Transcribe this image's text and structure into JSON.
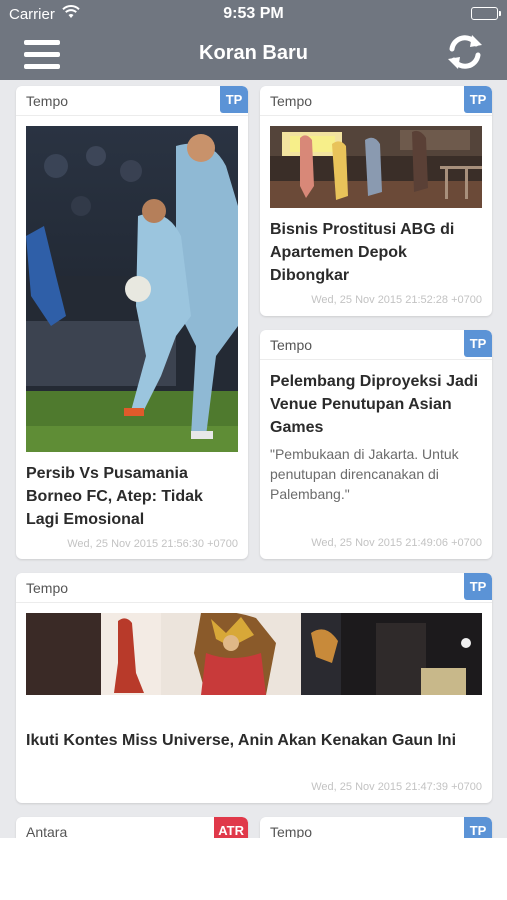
{
  "status_bar": {
    "carrier": "Carrier",
    "time": "9:53 PM"
  },
  "nav": {
    "title": "Koran Baru",
    "menu_icon": "hamburger-icon",
    "refresh_icon": "refresh-icon"
  },
  "colors": {
    "nav_bg": "#707680",
    "feed_bg": "#e8e9ec",
    "badge_tp": "#5b93d6",
    "badge_atr": "#e0394a"
  },
  "articles": [
    {
      "source": "Tempo",
      "badge": "TP",
      "headline": "Persib Vs Pusamania Borneo FC, Atep: Tidak Lagi Emosional",
      "excerpt": "",
      "time": "Wed, 25 Nov 2015 21:56:30 +0700"
    },
    {
      "source": "Tempo",
      "badge": "TP",
      "headline": "Bisnis Prostitusi ABG di Apartemen Depok Dibongkar",
      "excerpt": "",
      "time": "Wed, 25 Nov 2015 21:52:28 +0700"
    },
    {
      "source": "Tempo",
      "badge": "TP",
      "headline": "Pelembang Diproyeksi Jadi Venue Penutupan Asian Games",
      "excerpt": "\"Pembukaan di Jakarta. Untuk penutupan direncanakan di Palembang.\"",
      "time": "Wed, 25 Nov 2015 21:49:06 +0700"
    },
    {
      "source": "Tempo",
      "badge": "TP",
      "headline": "Ikuti Kontes Miss Universe, Anin Akan Kenakan Gaun Ini",
      "excerpt": "",
      "time": "Wed, 25 Nov 2015 21:47:39 +0700"
    },
    {
      "source": "Antara",
      "badge": "ATR",
      "headline": "",
      "excerpt": "",
      "time": ""
    },
    {
      "source": "Tempo",
      "badge": "TP",
      "headline": "",
      "excerpt": "",
      "time": ""
    }
  ]
}
